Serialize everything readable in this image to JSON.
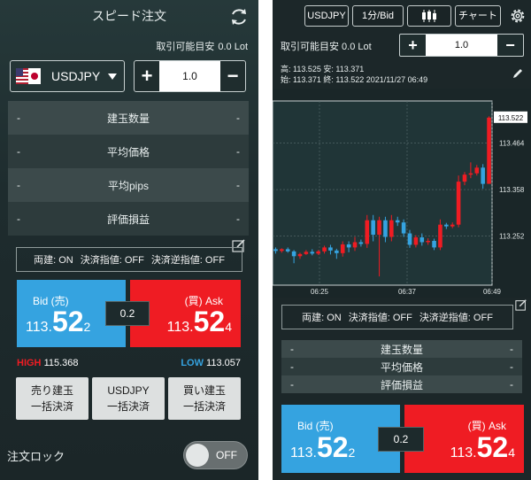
{
  "left": {
    "title": "スピード注文",
    "lot_label": "取引可能目安",
    "lot_value": "0.0 Lot",
    "pair": "USDJPY",
    "qty": "1.0",
    "qty_plus": "+",
    "qty_minus": "−",
    "rows": [
      {
        "dash_l": "-",
        "label": "建玉数量",
        "dash_r": "-"
      },
      {
        "dash_l": "-",
        "label": "平均価格",
        "dash_r": "-"
      },
      {
        "dash_l": "-",
        "label": "平均pips",
        "dash_r": "-"
      },
      {
        "dash_l": "-",
        "label": "評価損益",
        "dash_r": "-"
      }
    ],
    "status": {
      "both": "両建: ON",
      "limit": "決済指値: OFF",
      "stop": "決済逆指値: OFF"
    },
    "bid_label": "Bid (売)",
    "ask_label": "(買) Ask",
    "bid_a": "113.",
    "bid_b": "52",
    "bid_c": "2",
    "ask_a": "113.",
    "ask_b": "52",
    "ask_c": "4",
    "spread": "0.2",
    "high_label": "HIGH",
    "high_value": "115.368",
    "low_label": "LOW",
    "low_value": "113.057",
    "bulk": [
      {
        "l1": "売り建玉",
        "l2": "一括決済"
      },
      {
        "l1": "USDJPY",
        "l2": "一括決済"
      },
      {
        "l1": "買い建玉",
        "l2": "一括決済"
      }
    ],
    "lock_label": "注文ロック",
    "lock_state": "OFF"
  },
  "right": {
    "pair_btn": "USDJPY",
    "tf_btn": "1分/Bid",
    "chart_btn": "チャート",
    "lot_label": "取引可能目安 0.0 Lot",
    "qty": "1.0",
    "qty_plus": "+",
    "qty_minus": "−",
    "ohlc1": "高: 113.525  安: 113.371",
    "ohlc2": "始: 113.371  終: 113.522   2021/11/27 06:49",
    "status": {
      "both": "両建: ON",
      "limit": "決済指値: OFF",
      "stop": "決済逆指値: OFF"
    },
    "rows": [
      {
        "dash_l": "-",
        "label": "建玉数量",
        "dash_r": "-"
      },
      {
        "dash_l": "-",
        "label": "平均価格",
        "dash_r": "-"
      },
      {
        "dash_l": "-",
        "label": "評価損益",
        "dash_r": "-"
      }
    ],
    "bid_label": "Bid (売)",
    "ask_label": "(買) Ask",
    "bid_a": "113.",
    "bid_b": "52",
    "bid_c": "2",
    "ask_a": "113.",
    "ask_b": "52",
    "ask_c": "4",
    "spread": "0.2"
  },
  "colors": {
    "bid": "#35a3e0",
    "ask": "#ef1c23",
    "panel": "#1c2729"
  },
  "chart_data": {
    "type": "candlestick",
    "x_ticks": [
      "06:25",
      "06:37",
      "06:49"
    ],
    "y_ticks": [
      113.464,
      113.358,
      113.252
    ],
    "last_price_label": "113.522",
    "ylim": [
      113.14,
      113.56
    ],
    "candles": [
      {
        "o": 113.222,
        "c": 113.218,
        "h": 113.226,
        "l": 113.212
      },
      {
        "o": 113.218,
        "c": 113.222,
        "h": 113.224,
        "l": 113.214
      },
      {
        "o": 113.222,
        "c": 113.217,
        "h": 113.226,
        "l": 113.214
      },
      {
        "o": 113.217,
        "c": 113.206,
        "h": 113.22,
        "l": 113.19
      },
      {
        "o": 113.206,
        "c": 113.211,
        "h": 113.214,
        "l": 113.2
      },
      {
        "o": 113.211,
        "c": 113.216,
        "h": 113.22,
        "l": 113.209
      },
      {
        "o": 113.216,
        "c": 113.212,
        "h": 113.222,
        "l": 113.208
      },
      {
        "o": 113.212,
        "c": 113.217,
        "h": 113.22,
        "l": 113.209
      },
      {
        "o": 113.217,
        "c": 113.226,
        "h": 113.23,
        "l": 113.212
      },
      {
        "o": 113.226,
        "c": 113.219,
        "h": 113.232,
        "l": 113.21
      },
      {
        "o": 113.219,
        "c": 113.213,
        "h": 113.223,
        "l": 113.2
      },
      {
        "o": 113.213,
        "c": 113.233,
        "h": 113.24,
        "l": 113.205
      },
      {
        "o": 113.233,
        "c": 113.226,
        "h": 113.24,
        "l": 113.215
      },
      {
        "o": 113.226,
        "c": 113.238,
        "h": 113.25,
        "l": 113.218
      },
      {
        "o": 113.238,
        "c": 113.234,
        "h": 113.244,
        "l": 113.228
      },
      {
        "o": 113.234,
        "c": 113.288,
        "h": 113.3,
        "l": 113.225
      },
      {
        "o": 113.288,
        "c": 113.255,
        "h": 113.3,
        "l": 113.24
      },
      {
        "o": 113.255,
        "c": 113.288,
        "h": 113.296,
        "l": 113.16
      },
      {
        "o": 113.288,
        "c": 113.25,
        "h": 113.296,
        "l": 113.238
      },
      {
        "o": 113.25,
        "c": 113.288,
        "h": 113.3,
        "l": 113.24
      },
      {
        "o": 113.288,
        "c": 113.283,
        "h": 113.296,
        "l": 113.275
      },
      {
        "o": 113.283,
        "c": 113.258,
        "h": 113.29,
        "l": 113.25
      },
      {
        "o": 113.258,
        "c": 113.232,
        "h": 113.266,
        "l": 113.225
      },
      {
        "o": 113.232,
        "c": 113.249,
        "h": 113.254,
        "l": 113.226
      },
      {
        "o": 113.249,
        "c": 113.238,
        "h": 113.258,
        "l": 113.23
      },
      {
        "o": 113.238,
        "c": 113.241,
        "h": 113.247,
        "l": 113.232
      },
      {
        "o": 113.241,
        "c": 113.226,
        "h": 113.246,
        "l": 113.22
      },
      {
        "o": 113.226,
        "c": 113.278,
        "h": 113.29,
        "l": 113.22
      },
      {
        "o": 113.278,
        "c": 113.274,
        "h": 113.282,
        "l": 113.268
      },
      {
        "o": 113.274,
        "c": 113.278,
        "h": 113.283,
        "l": 113.27
      },
      {
        "o": 113.278,
        "c": 113.376,
        "h": 113.39,
        "l": 113.272
      },
      {
        "o": 113.376,
        "c": 113.392,
        "h": 113.398,
        "l": 113.368
      },
      {
        "o": 113.392,
        "c": 113.395,
        "h": 113.42,
        "l": 113.384
      },
      {
        "o": 113.395,
        "c": 113.408,
        "h": 113.414,
        "l": 113.39
      },
      {
        "o": 113.408,
        "c": 113.371,
        "h": 113.416,
        "l": 113.36
      },
      {
        "o": 113.371,
        "c": 113.522,
        "h": 113.525,
        "l": 113.371
      }
    ]
  }
}
